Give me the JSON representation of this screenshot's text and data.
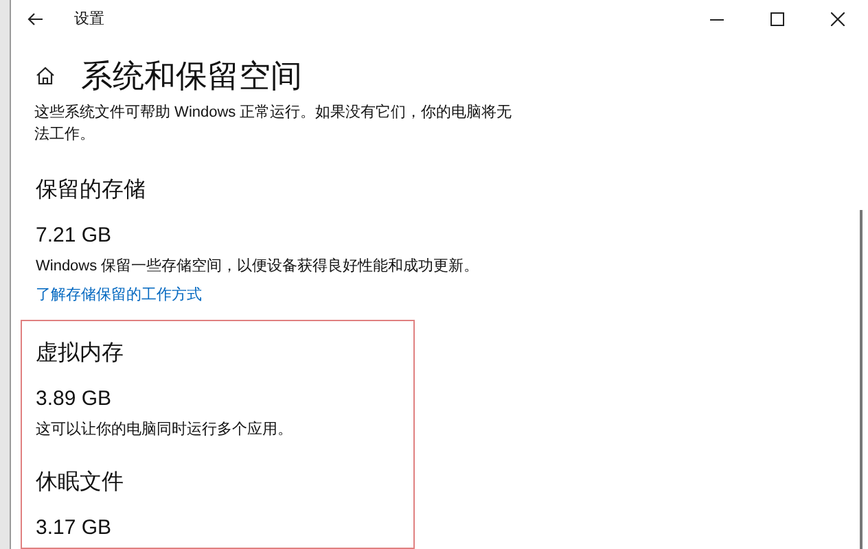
{
  "window": {
    "title": "设置"
  },
  "page": {
    "title": "系统和保留空间",
    "description": "这些系统文件可帮助 Windows 正常运行。如果没有它们，你的电脑将无法工作。"
  },
  "sections": [
    {
      "title": "保留的存储",
      "size": "7.21 GB",
      "description": "Windows 保留一些存储空间，以便设备获得良好性能和成功更新。",
      "link": "了解存储保留的工作方式"
    }
  ],
  "highlighted_sections": [
    {
      "title": "虚拟内存",
      "size": "3.89 GB",
      "description": "这可以让你的电脑同时运行多个应用。"
    },
    {
      "title": "休眠文件",
      "size": "3.17 GB"
    }
  ]
}
